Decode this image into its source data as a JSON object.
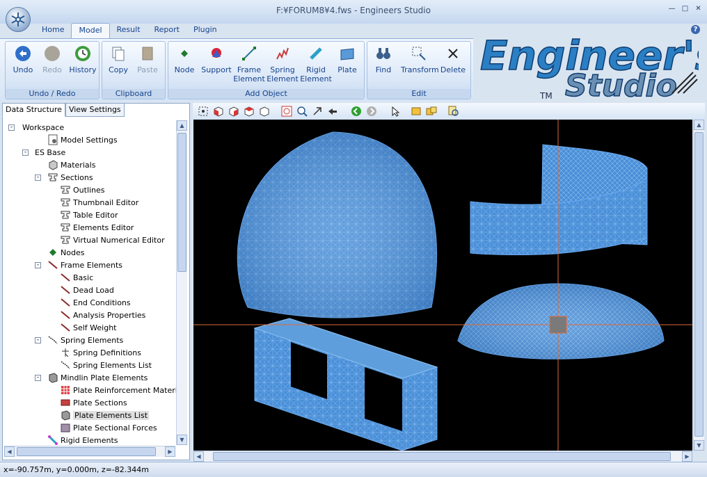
{
  "window": {
    "title": "F:¥FORUM8¥4.fws - Engineers Studio"
  },
  "tabs": [
    {
      "label": "Home"
    },
    {
      "label": "Model"
    },
    {
      "label": "Result"
    },
    {
      "label": "Report"
    },
    {
      "label": "Plugin"
    }
  ],
  "ribbon": {
    "groups": [
      {
        "label": "Undo / Redo"
      },
      {
        "label": "Clipboard"
      },
      {
        "label": "Add Object"
      },
      {
        "label": "Edit"
      }
    ],
    "buttons": {
      "undo": "Undo",
      "redo": "Redo",
      "history": "History",
      "copy": "Copy",
      "paste": "Paste",
      "node": "Node",
      "support": "Support",
      "frame": "Frame Element",
      "spring": "Spring Element",
      "rigid": "Rigid Element",
      "plate": "Plate",
      "find": "Find",
      "transform": "Transform",
      "delete": "Delete"
    }
  },
  "logo": {
    "line1": "Engineer's",
    "line2": "Studio",
    "tm": "TM"
  },
  "panel_tabs": [
    "Data Structure",
    "View Settings"
  ],
  "tree": [
    {
      "label": "Workspace",
      "level": 0,
      "exp": "-",
      "icon": "none"
    },
    {
      "label": "Model Settings",
      "level": 2,
      "icon": "settings"
    },
    {
      "label": "ES Base",
      "level": 1,
      "exp": "-",
      "icon": "none"
    },
    {
      "label": "Materials",
      "level": 2,
      "icon": "material"
    },
    {
      "label": "Sections",
      "level": 2,
      "exp": "-",
      "icon": "section"
    },
    {
      "label": "Outlines",
      "level": 3,
      "icon": "section"
    },
    {
      "label": "Thumbnail Editor",
      "level": 3,
      "icon": "section"
    },
    {
      "label": "Table Editor",
      "level": 3,
      "icon": "section"
    },
    {
      "label": "Elements Editor",
      "level": 3,
      "icon": "section"
    },
    {
      "label": "Virtual Numerical Editor",
      "level": 3,
      "icon": "section"
    },
    {
      "label": "Nodes",
      "level": 2,
      "icon": "node"
    },
    {
      "label": "Frame Elements",
      "level": 2,
      "exp": "-",
      "icon": "frame"
    },
    {
      "label": "Basic",
      "level": 3,
      "icon": "frame"
    },
    {
      "label": "Dead Load",
      "level": 3,
      "icon": "frame"
    },
    {
      "label": "End Conditions",
      "level": 3,
      "icon": "frame"
    },
    {
      "label": "Analysis Properties",
      "level": 3,
      "icon": "frame"
    },
    {
      "label": "Self Weight",
      "level": 3,
      "icon": "frame"
    },
    {
      "label": "Spring Elements",
      "level": 2,
      "exp": "-",
      "icon": "spring"
    },
    {
      "label": "Spring Definitions",
      "level": 3,
      "icon": "springdef"
    },
    {
      "label": "Spring Elements List",
      "level": 3,
      "icon": "spring"
    },
    {
      "label": "Mindlin Plate Elements",
      "level": 2,
      "exp": "-",
      "icon": "plate"
    },
    {
      "label": "Plate Reinforcement Materials",
      "level": 3,
      "icon": "reinf"
    },
    {
      "label": "Plate Sections",
      "level": 3,
      "icon": "platesec"
    },
    {
      "label": "Plate Elements List",
      "level": 3,
      "icon": "plate",
      "selected": true
    },
    {
      "label": "Plate Sectional Forces",
      "level": 3,
      "icon": "forces"
    },
    {
      "label": "Rigid Elements",
      "level": 2,
      "icon": "rigid"
    }
  ],
  "status": {
    "coords": "x=-90.757m, y=0.000m, z=-82.344m"
  },
  "colors": {
    "mesh": "#4a8fd8",
    "crosshair": "#e06a3a",
    "ribbon_text": "#15428b"
  }
}
